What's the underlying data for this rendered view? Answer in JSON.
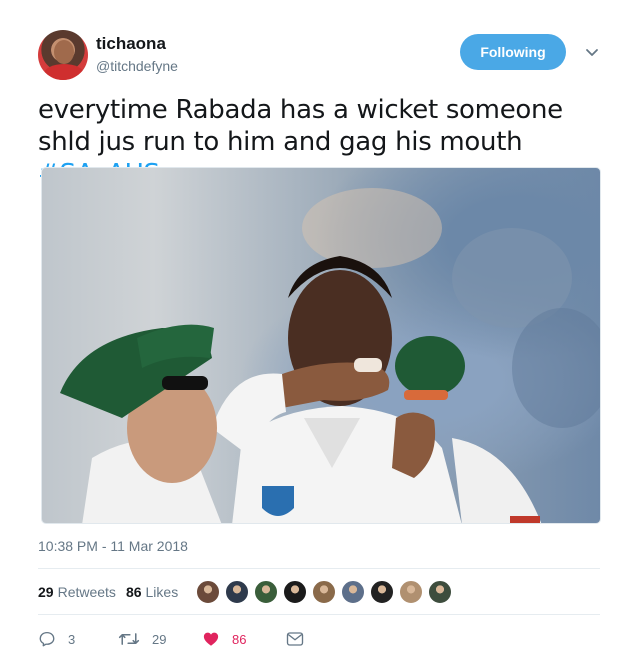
{
  "user": {
    "name": "tichaona",
    "handle": "@titchdefyne"
  },
  "follow_button": {
    "label": "Following",
    "color": "#4aa8e6"
  },
  "tweet": {
    "text": "everytime Rabada has a wicket someone shld jus run to him and gag his mouth ",
    "hashtag": "#SAvAUS"
  },
  "timestamp": "10:38 PM - 11 Mar 2018",
  "stats": {
    "retweets_count": "29",
    "retweets_label": "Retweets",
    "likes_count": "86",
    "likes_label": "Likes"
  },
  "likers": [
    {
      "icon": "avatar-1",
      "color": "#6b4a3a"
    },
    {
      "icon": "avatar-2",
      "color": "#2e3a4c"
    },
    {
      "icon": "avatar-3",
      "color": "#3a5e3a"
    },
    {
      "icon": "avatar-4",
      "color": "#1b1b1b"
    },
    {
      "icon": "avatar-5",
      "color": "#8a6a4a"
    },
    {
      "icon": "avatar-6",
      "color": "#5d6f8a"
    },
    {
      "icon": "avatar-7",
      "color": "#222222"
    },
    {
      "icon": "avatar-8",
      "color": "#b09070"
    },
    {
      "icon": "avatar-9",
      "color": "#3d4d3d"
    }
  ],
  "actions": {
    "replies": "3",
    "retweets": "29",
    "likes": "86"
  },
  "colors": {
    "link": "#1da1f2",
    "like": "#e0245e",
    "muted": "#657786"
  }
}
